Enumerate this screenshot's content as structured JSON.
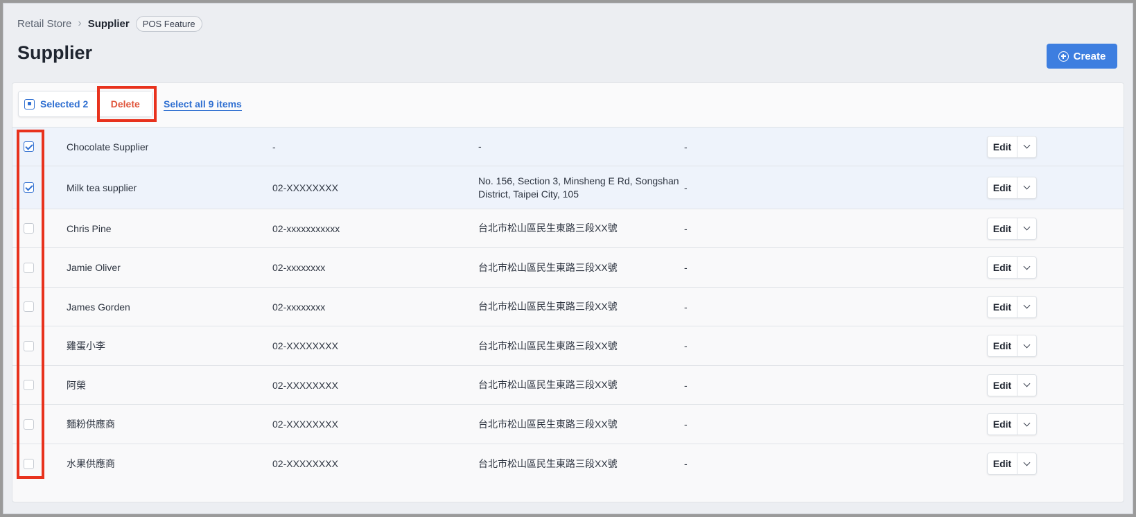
{
  "breadcrumb": {
    "root": "Retail Store",
    "current": "Supplier",
    "badge": "POS Feature"
  },
  "page": {
    "title": "Supplier",
    "create_label": "Create"
  },
  "toolbar": {
    "selected_label": "Selected 2",
    "delete_label": "Delete",
    "select_all_label": "Select all 9 items"
  },
  "table": {
    "edit_label": "Edit",
    "rows": [
      {
        "name": "Chocolate Supplier",
        "phone": "-",
        "address": "-",
        "note": "-",
        "checked": true
      },
      {
        "name": "Milk tea supplier",
        "phone": "02-XXXXXXXX",
        "address": "No. 156, Section 3, Minsheng E Rd, Songshan District, Taipei City, 105",
        "note": "-",
        "checked": true
      },
      {
        "name": "Chris Pine",
        "phone": "02-xxxxxxxxxxx",
        "address": "台北市松山區民生東路三段XX號",
        "note": "-",
        "checked": false
      },
      {
        "name": "Jamie Oliver",
        "phone": "02-xxxxxxxx",
        "address": "台北市松山區民生東路三段XX號",
        "note": "-",
        "checked": false
      },
      {
        "name": "James Gorden",
        "phone": "02-xxxxxxxx",
        "address": "台北市松山區民生東路三段XX號",
        "note": "-",
        "checked": false
      },
      {
        "name": "雞蛋小李",
        "phone": "02-XXXXXXXX",
        "address": "台北市松山區民生東路三段XX號",
        "note": "-",
        "checked": false
      },
      {
        "name": "阿榮",
        "phone": "02-XXXXXXXX",
        "address": "台北市松山區民生東路三段XX號",
        "note": "-",
        "checked": false
      },
      {
        "name": "麵粉供應商",
        "phone": "02-XXXXXXXX",
        "address": "台北市松山區民生東路三段XX號",
        "note": "-",
        "checked": false
      },
      {
        "name": "水果供應商",
        "phone": "02-XXXXXXXX",
        "address": "台北市松山區民生東路三段XX號",
        "note": "-",
        "checked": false
      }
    ]
  },
  "colors": {
    "accent": "#3d7ee0",
    "danger": "#e0553b",
    "highlight": "#e8321d"
  }
}
